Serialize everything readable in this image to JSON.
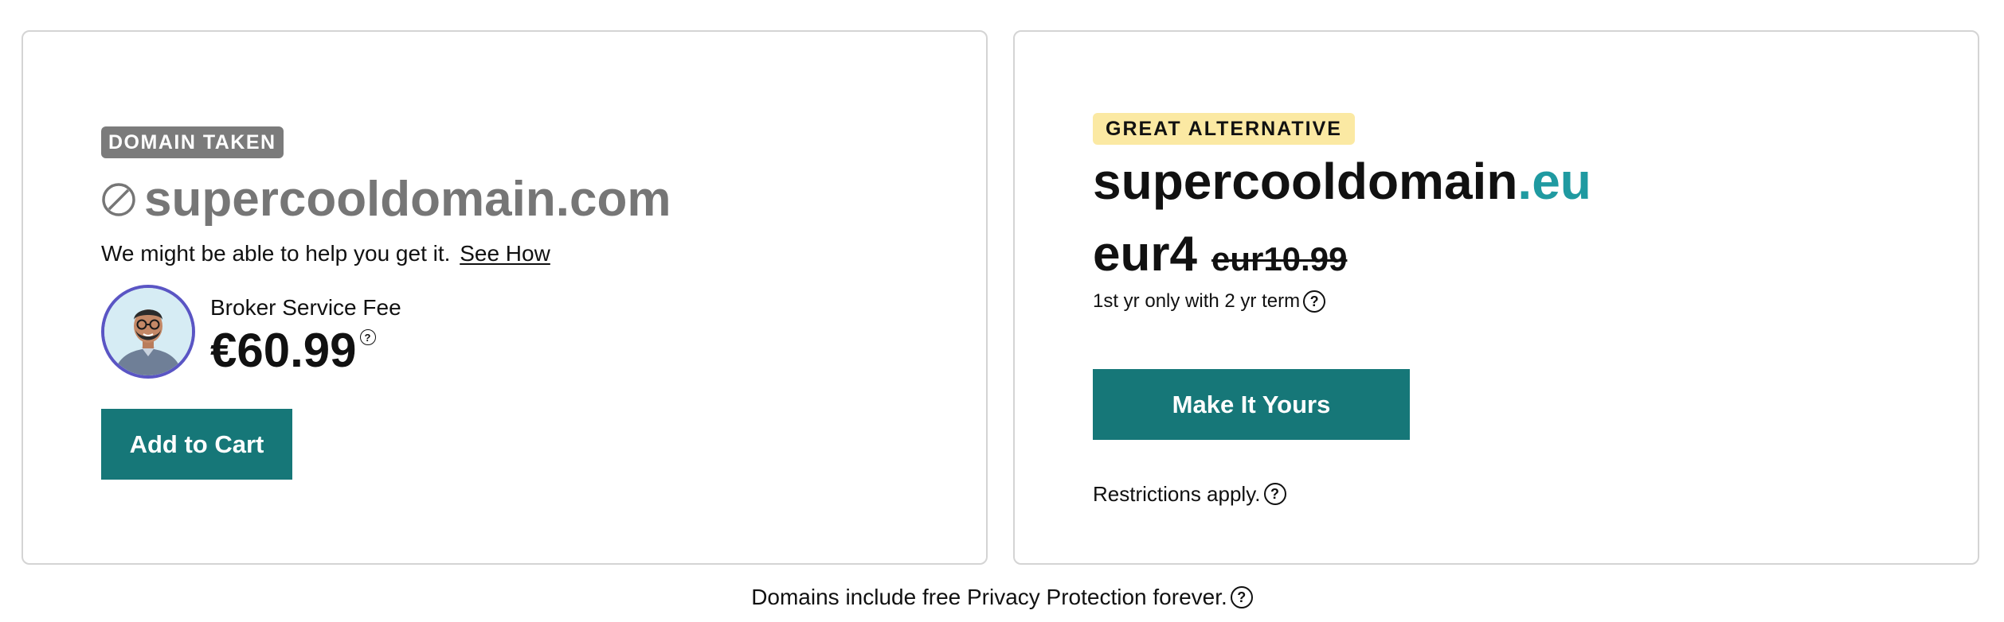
{
  "taken_card": {
    "badge": "DOMAIN TAKEN",
    "domain": "supercooldomain.com",
    "help_text": "We might be able to help you get it.",
    "help_link": "See How",
    "broker_label": "Broker Service Fee",
    "broker_price": "€60.99",
    "help_icon_glyph": "?",
    "add_to_cart_label": "Add to Cart"
  },
  "alternative_card": {
    "badge": "GREAT ALTERNATIVE",
    "domain_name": "supercooldomain",
    "domain_tld": ".eu",
    "price_new": "eur4",
    "price_old": "eur10.99",
    "term_text": "1st yr only with 2 yr term",
    "help_icon_glyph": "?",
    "cta_label": "Make It Yours",
    "restrictions_text": "Restrictions apply.",
    "restrictions_icon_glyph": "?"
  },
  "footer": {
    "text": "Domains include free Privacy Protection forever.",
    "help_icon_glyph": "?"
  },
  "icons": {
    "taken": "ban-icon",
    "help": "question-circle-icon",
    "avatar": "broker-avatar"
  },
  "colors": {
    "primary_button": "#167778",
    "tld_accent": "#1f9aa1",
    "taken_badge": "#7b7b7b",
    "alt_badge": "#fbe9a3",
    "avatar_ring": "#5a55c4"
  }
}
